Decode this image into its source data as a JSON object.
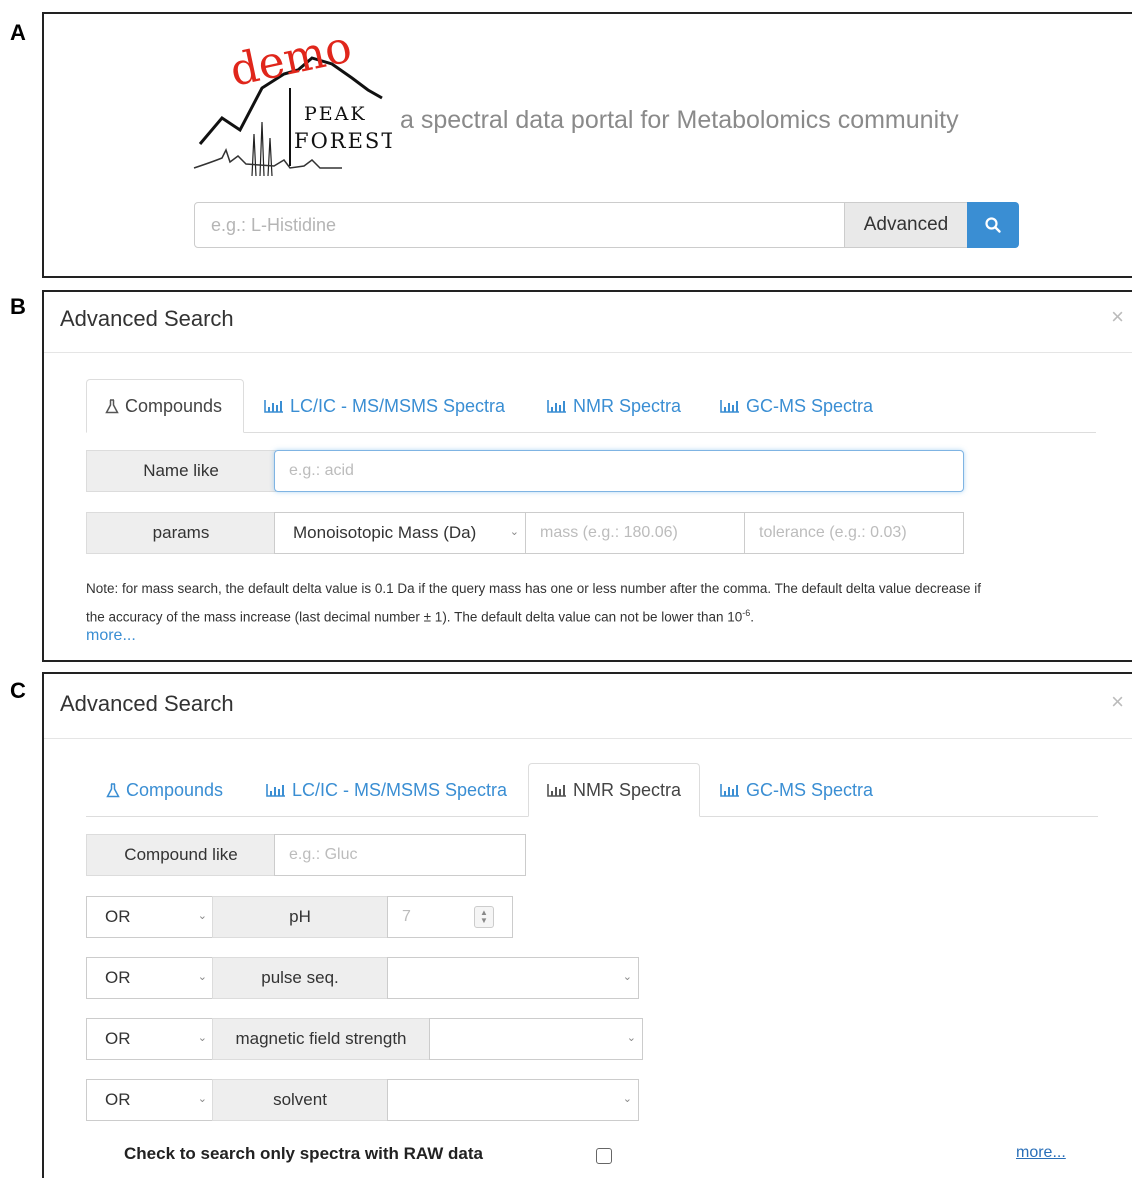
{
  "panel_labels": [
    "A",
    "B",
    "C"
  ],
  "panelA": {
    "logo": {
      "demo_text": "demo",
      "line1": "PEAK",
      "line2": "FOREST"
    },
    "tagline": "a spectral data portal for Metabolomics community",
    "search": {
      "placeholder": "e.g.: L-Histidine",
      "value": ""
    },
    "advanced_button": "Advanced",
    "search_button_icon": "search-icon"
  },
  "panelB": {
    "title": "Advanced Search",
    "close": "×",
    "tabs": [
      {
        "label": "Compounds",
        "icon": "flask-icon",
        "active": true
      },
      {
        "label": "LC/IC - MS/MSMS Spectra",
        "icon": "bar-chart-icon",
        "active": false
      },
      {
        "label": "NMR Spectra",
        "icon": "bar-chart-icon",
        "active": false
      },
      {
        "label": "GC-MS Spectra",
        "icon": "bar-chart-icon",
        "active": false
      }
    ],
    "name_like": {
      "label": "Name like",
      "placeholder": "e.g.: acid"
    },
    "params": {
      "label": "params",
      "select_value": "Monoisotopic Mass (Da)",
      "mass_placeholder": "mass (e.g.: 180.06)",
      "tolerance_placeholder": "tolerance (e.g.: 0.03)"
    },
    "note_line1": "Note: for mass search, the default delta value is 0.1 Da if the query mass has one or less number after the comma. The default delta value decrease if",
    "note_line2_pre": "the accuracy of the mass increase (last decimal number ± 1). The default delta value can not be lower than 10",
    "note_sup": "-6",
    "note_end": ".",
    "more": "more..."
  },
  "panelC": {
    "title": "Advanced Search",
    "close": "×",
    "tabs": [
      {
        "label": "Compounds",
        "icon": "flask-icon",
        "active": false
      },
      {
        "label": "LC/IC - MS/MSMS Spectra",
        "icon": "bar-chart-icon",
        "active": false
      },
      {
        "label": "NMR Spectra",
        "icon": "bar-chart-icon",
        "active": true
      },
      {
        "label": "GC-MS Spectra",
        "icon": "bar-chart-icon",
        "active": false
      }
    ],
    "compound_like": {
      "label": "Compound like",
      "placeholder": "e.g.: Gluc"
    },
    "rows": [
      {
        "operator": "OR",
        "label": "pH",
        "value_placeholder": "7"
      },
      {
        "operator": "OR",
        "label": "pulse seq.",
        "value": ""
      },
      {
        "operator": "OR",
        "label": "magnetic field strength",
        "value": ""
      },
      {
        "operator": "OR",
        "label": "solvent",
        "value": ""
      }
    ],
    "raw_label": "Check to search only spectra with RAW data",
    "raw_checked": false,
    "more": "more..."
  },
  "colors": {
    "accent": "#3a8ed3",
    "demo_red": "#e0261b"
  }
}
